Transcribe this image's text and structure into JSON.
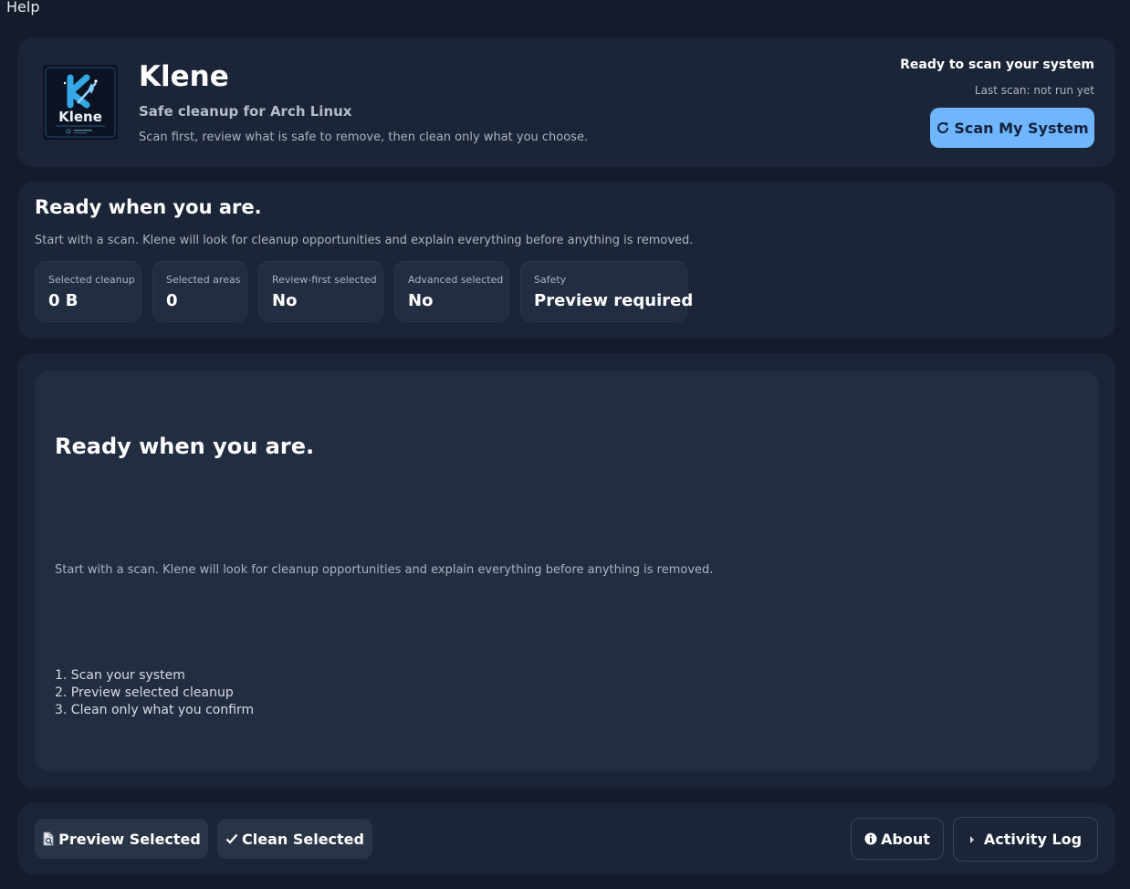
{
  "menubar": {
    "help": "Help"
  },
  "header": {
    "logo_text": "Klene",
    "title": "Klene",
    "subtitle": "Safe cleanup for Arch Linux",
    "description": "Scan first, review what is safe to remove, then clean only what you choose.",
    "status": "Ready to scan your system",
    "last_scan": "Last scan: not run yet",
    "scan_button": "Scan My System",
    "scan_icon": "refresh-icon"
  },
  "summary": {
    "title": "Ready when you are.",
    "description": "Start with a scan. Klene will look for cleanup opportunities and explain everything before anything is removed.",
    "stats": [
      {
        "label": "Selected cleanup",
        "value": "0 B"
      },
      {
        "label": "Selected areas",
        "value": "0"
      },
      {
        "label": "Review-first selected",
        "value": "No"
      },
      {
        "label": "Advanced selected",
        "value": "No"
      },
      {
        "label": "Safety",
        "value": "Preview required"
      }
    ]
  },
  "main": {
    "title": "Ready when you are.",
    "description": "Start with a scan. Klene will look for cleanup opportunities and explain everything before anything is removed.",
    "steps": [
      "1. Scan your system",
      "2. Preview selected cleanup",
      "3. Clean only what you confirm"
    ]
  },
  "footer": {
    "preview_button": "Preview Selected",
    "preview_icon": "document-preview-icon",
    "clean_button": "Clean Selected",
    "clean_icon": "check-icon",
    "about_button": "About",
    "about_icon": "info-icon",
    "activity_button": "Activity Log",
    "activity_icon": "caret-right-icon"
  },
  "colors": {
    "background": "#141b2a",
    "card": "#1c2538",
    "panel": "#232d41",
    "accent": "#6fb6ff"
  }
}
